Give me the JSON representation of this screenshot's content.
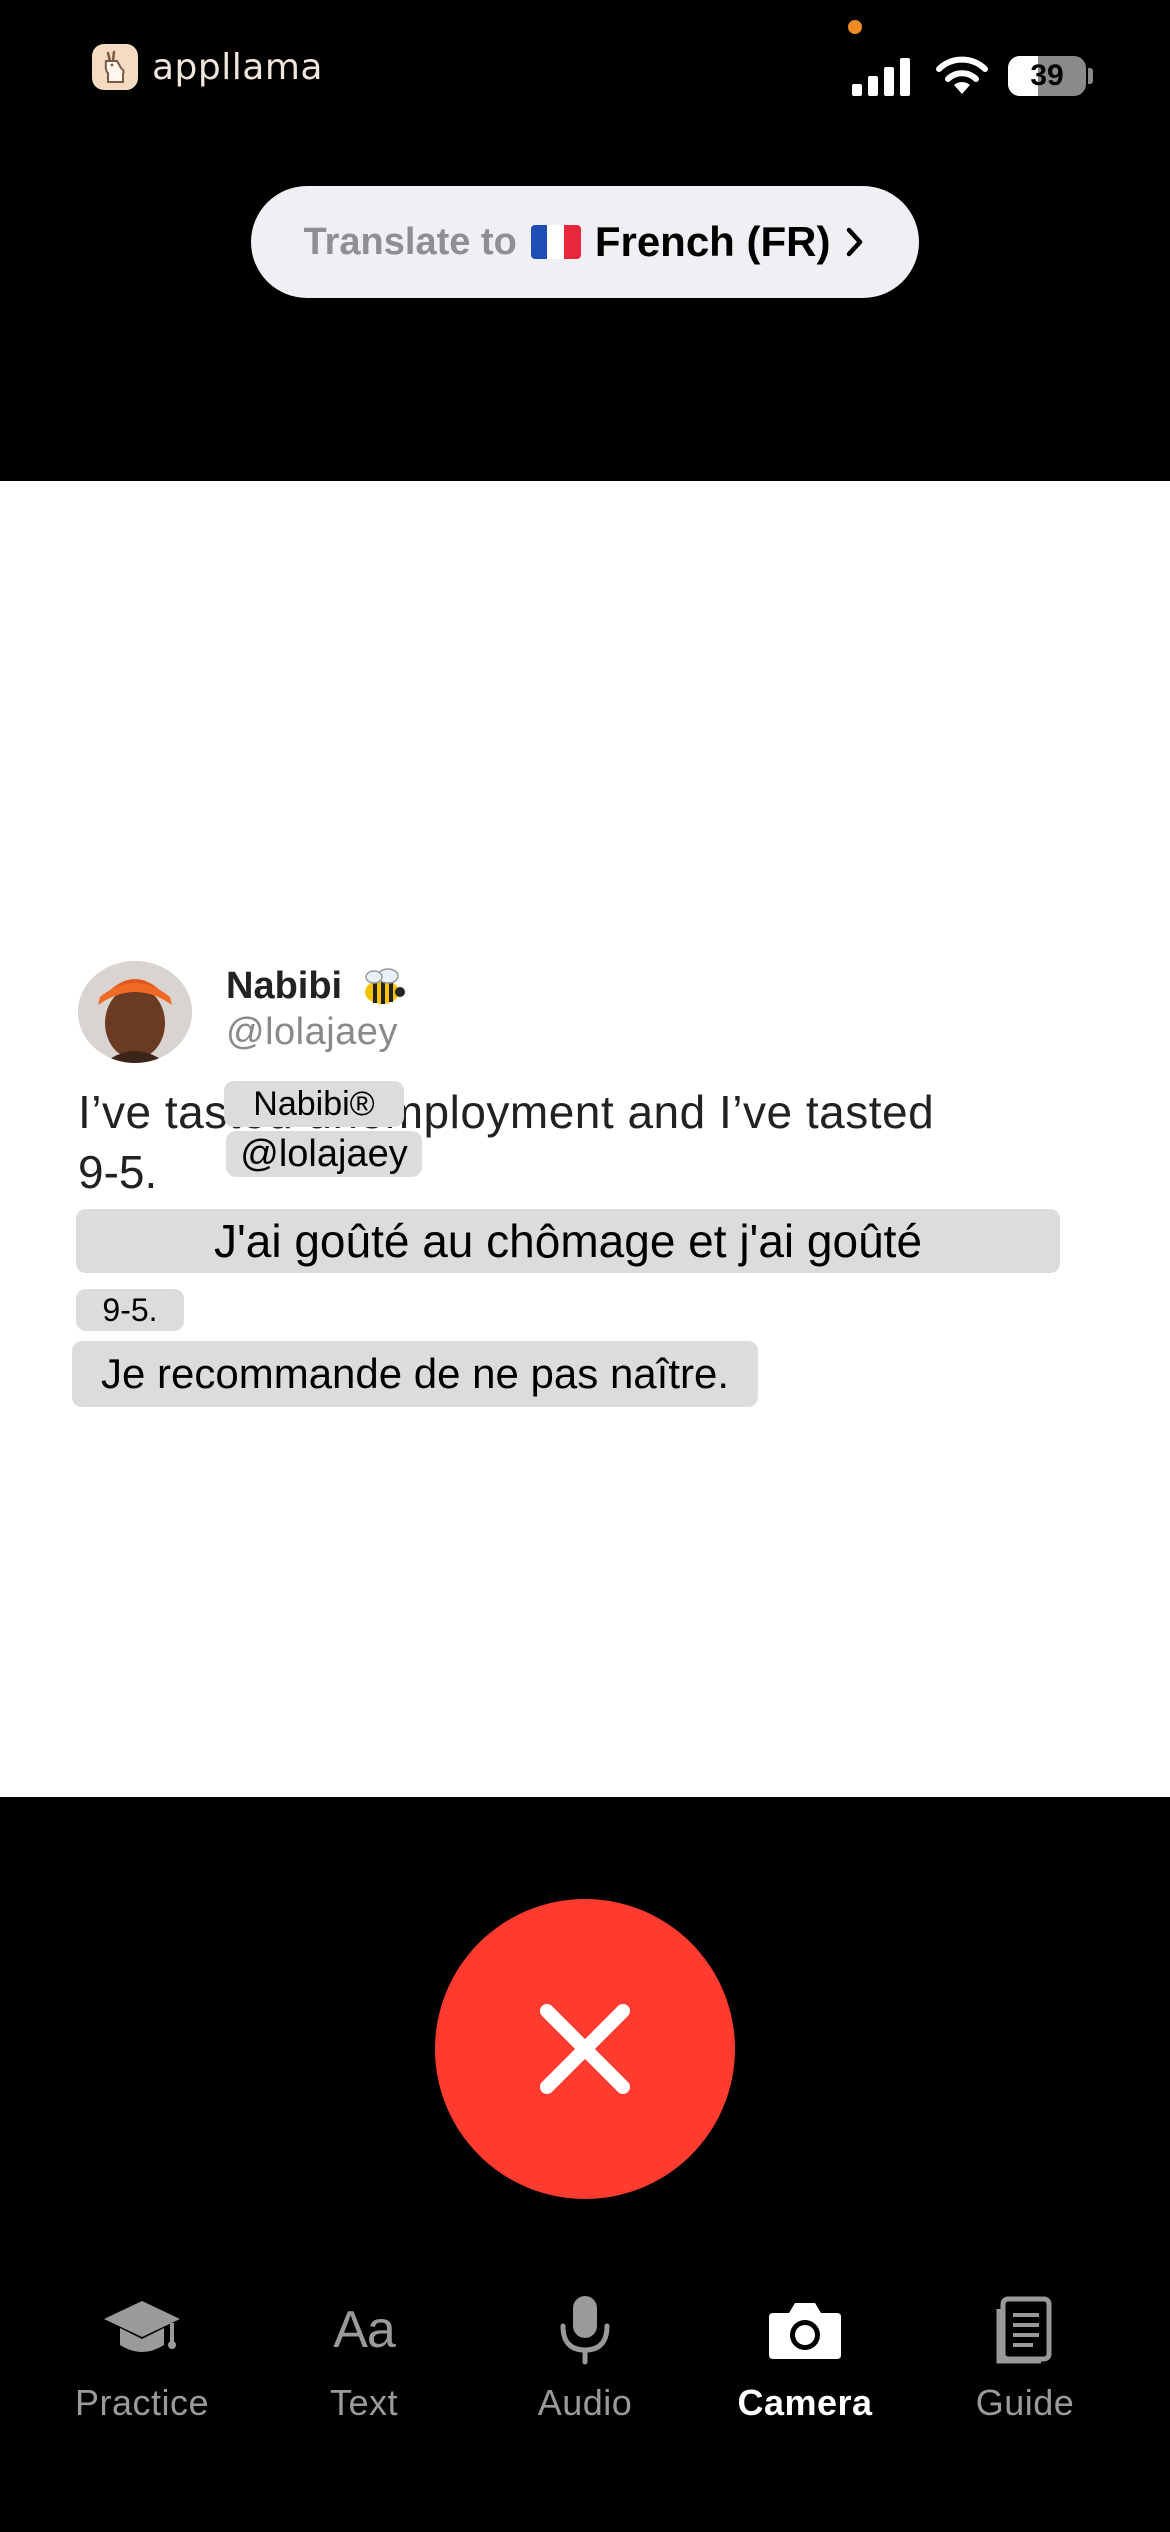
{
  "status_bar": {
    "app_name": "appllama",
    "app_icon": "llama-logo-icon",
    "battery_percent": 39,
    "battery_text": "39",
    "colors": {
      "privacy_dot": "#f08a24"
    }
  },
  "translate_pill": {
    "prefix": "Translate to",
    "flag_icon": "france-flag-icon",
    "language": "French (FR)",
    "chevron_icon": "chevron-right-icon"
  },
  "capture": {
    "tweet": {
      "display_name": "Nabibi",
      "name_emoji": "bee-icon",
      "handle": "@lolajaey",
      "line1": "I’ve tasted unemployment and I’ve tasted",
      "line2": "9-5."
    },
    "translation_overlays": {
      "name": "Nabibi®",
      "handle": "@lolajaey",
      "line1": "J'ai goûté au chômage et j'ai goûté",
      "line2": "9-5.",
      "line3": "Je recommande de ne pas naître."
    }
  },
  "cancel_button": {
    "icon": "close-icon",
    "color": "#ff3b30"
  },
  "tabs": [
    {
      "label": "Practice",
      "icon": "graduation-cap-icon",
      "active": false
    },
    {
      "label": "Text",
      "icon": "text-aa-icon",
      "glyph": "Aa",
      "active": false
    },
    {
      "label": "Audio",
      "icon": "microphone-icon",
      "active": false
    },
    {
      "label": "Camera",
      "icon": "camera-icon",
      "active": true
    },
    {
      "label": "Guide",
      "icon": "book-icon",
      "active": false
    }
  ]
}
